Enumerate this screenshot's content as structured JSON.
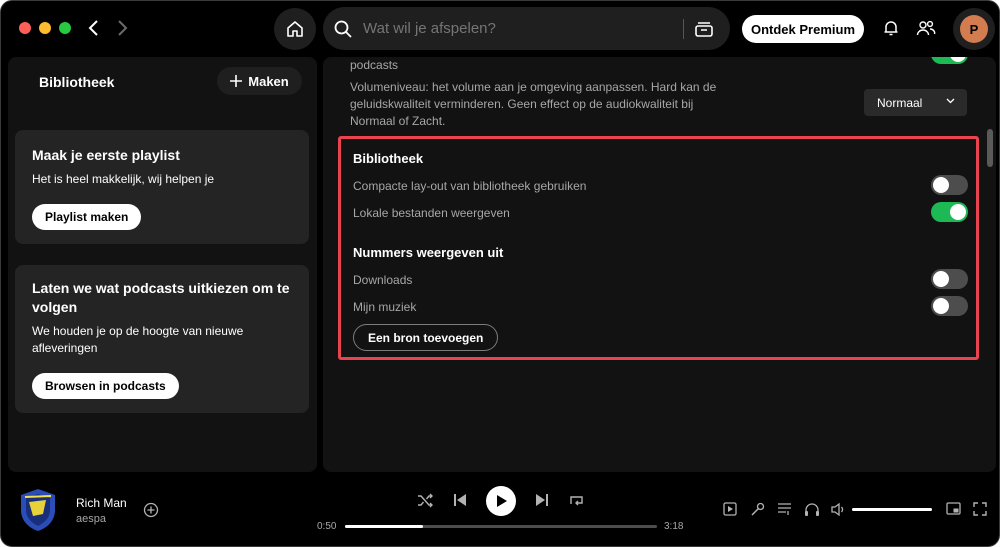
{
  "topbar": {
    "search_placeholder": "Wat wil je afspelen?",
    "premium_label": "Ontdek Premium",
    "avatar_initial": "P"
  },
  "library": {
    "title": "Bibliotheek",
    "create_label": "Maken",
    "cards": [
      {
        "title": "Maak je eerste playlist",
        "subtitle": "Het is heel makkelijk, wij helpen je",
        "button": "Playlist maken"
      },
      {
        "title": "Laten we wat podcasts uitkiezen om te volgen",
        "subtitle": "We houden je op de hoogte van nieuwe afleveringen",
        "button": "Browsen in podcasts"
      }
    ]
  },
  "settings": {
    "prev_partial": "podcasts",
    "volume_desc": "Volumeniveau: het volume aan je omgeving aanpassen. Hard kan de geluidskwaliteit verminderen. Geen effect op de audiokwaliteit bij Normaal of Zacht.",
    "volume_desc_lines": [
      "Volumeniveau: het volume aan je omgeving aanpassen. Hard kan de",
      "geluidskwaliteit verminderen. Geen effect op de audiokwaliteit bij",
      "Normaal of Zacht."
    ],
    "volume_level_value": "Normaal",
    "library_section": {
      "heading": "Bibliotheek",
      "compact_label": "Compacte lay-out van bibliotheek gebruiken",
      "compact_on": false,
      "local_files_label": "Lokale bestanden weergeven",
      "local_files_on": true
    },
    "sources_section": {
      "heading": "Nummers weergeven uit",
      "downloads_label": "Downloads",
      "downloads_on": false,
      "mymusic_label": "Mijn muziek",
      "mymusic_on": false,
      "add_source_label": "Een bron toevoegen"
    }
  },
  "player": {
    "track_title": "Rich Man",
    "track_artist": "aespa",
    "elapsed": "0:50",
    "duration": "3:18",
    "progress": 0.25,
    "volume": 1.0
  },
  "colors": {
    "accent_green": "#1db954",
    "highlight_red": "#e8434f"
  }
}
